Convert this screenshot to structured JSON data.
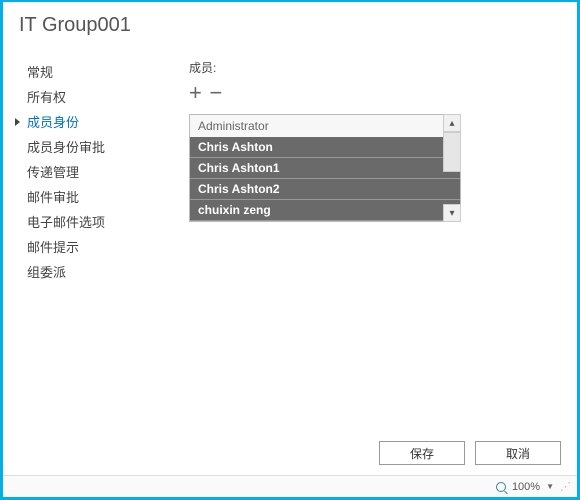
{
  "title": "IT Group001",
  "sidebar": {
    "items": [
      {
        "label": "常规"
      },
      {
        "label": "所有权"
      },
      {
        "label": "成员身份",
        "active": true
      },
      {
        "label": "成员身份审批"
      },
      {
        "label": "传递管理"
      },
      {
        "label": "邮件审批"
      },
      {
        "label": "电子邮件选项"
      },
      {
        "label": "邮件提示"
      },
      {
        "label": "组委派"
      }
    ]
  },
  "members": {
    "label": "成员:",
    "add_label": "+",
    "remove_label": "−",
    "list": [
      {
        "name": "Administrator",
        "selected": false
      },
      {
        "name": "Chris Ashton",
        "selected": true
      },
      {
        "name": "Chris Ashton1",
        "selected": true
      },
      {
        "name": "Chris Ashton2",
        "selected": true
      },
      {
        "name": "chuixin zeng",
        "selected": true
      }
    ]
  },
  "footer": {
    "save_label": "保存",
    "cancel_label": "取消"
  },
  "status": {
    "zoom_text": "100%"
  }
}
